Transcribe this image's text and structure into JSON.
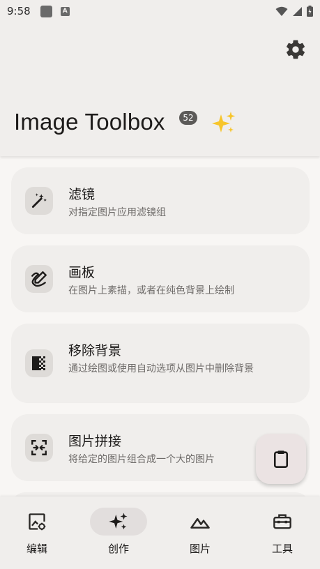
{
  "status_bar": {
    "time": "9:58",
    "a_icon_letter": "A"
  },
  "header": {
    "title": "Image Toolbox",
    "version_badge": "52"
  },
  "cards": [
    {
      "title": "滤镜",
      "description": "对指定图片应用滤镜组",
      "icon": "magic-wand-icon"
    },
    {
      "title": "画板",
      "description": "在图片上素描，或者在纯色背景上绘制",
      "icon": "draw-icon"
    },
    {
      "title": "移除背景",
      "description": "通过绘图或使用自动选项从图片中删除背景",
      "icon": "background-remove-icon"
    },
    {
      "title": "图片拼接",
      "description": "将给定的图片组合成一个大的图片",
      "icon": "stitch-icon"
    }
  ],
  "nav": [
    {
      "label": "编辑",
      "icon": "image-edit-icon",
      "active": false
    },
    {
      "label": "创作",
      "icon": "sparkles-icon",
      "active": true
    },
    {
      "label": "图片",
      "icon": "landscape-icon",
      "active": false
    },
    {
      "label": "工具",
      "icon": "toolbox-icon",
      "active": false
    }
  ],
  "colors": {
    "background": "#f8f6f4",
    "surface": "#f0eeec",
    "icon_container": "#dedbd8",
    "badge": "#5c5a58",
    "fab": "#ebe3e3"
  }
}
